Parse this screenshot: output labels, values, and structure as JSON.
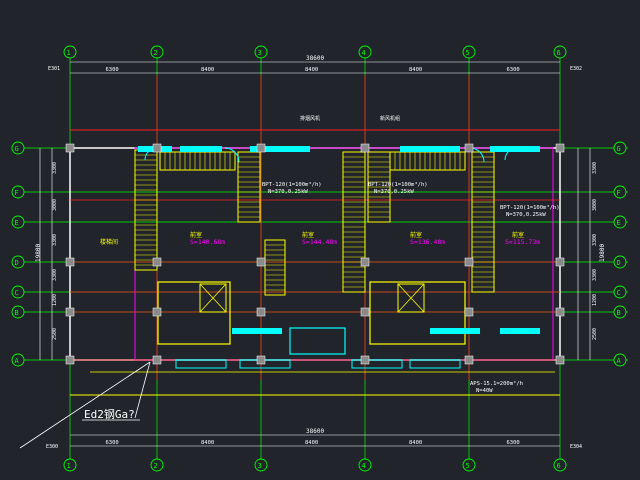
{
  "title": "CAD floor plan drawing",
  "colors": {
    "background": "#21242b",
    "axis": "#00ff00",
    "wall": "#ffffff",
    "grid_red": "#ff2020",
    "yellow": "#ffff00",
    "magenta": "#ff00ff",
    "cyan": "#00ffff",
    "dim": "#ffffff"
  },
  "axes": {
    "columns": [
      "①",
      "②",
      "③",
      "④",
      "⑤",
      "⑥"
    ],
    "rows": [
      "Ⓐ",
      "Ⓑ",
      "Ⓒ",
      "Ⓓ",
      "Ⓔ",
      "Ⓕ",
      "Ⓖ"
    ]
  },
  "dimensions": {
    "top_total": "38600",
    "bottom_total": "38600",
    "bays": [
      "6300",
      "8400",
      "8400",
      "8400",
      "6300"
    ],
    "left_total": "19800",
    "left_segments": [
      "2500",
      "1200",
      "3300",
      "3300",
      "3000",
      "3300"
    ]
  },
  "elevation_marks": {
    "top_left": "E301",
    "top_right": "E302",
    "bottom_left": "E300",
    "bottom_right": "E304"
  },
  "rooms": [
    {
      "label": "前室",
      "area": "S=140.68m"
    },
    {
      "label": "前室",
      "area": "S=144.48m"
    },
    {
      "label": "前室",
      "area": "S=136.48m"
    },
    {
      "label": "前室",
      "area": "S=115.73m"
    }
  ],
  "left_room": "楼梯间",
  "equipment_labels": [
    "BPT-120(1=100m³/h)",
    "N=370,0.25kW",
    "BPT-120(1=100m³/h)",
    "N=370,0.25kW",
    "BPT-120(1=100m³/h)",
    "N=370,0.25kW",
    "APS-15.1=200m³/h",
    "N=40W"
  ],
  "callout": "Ed2钢Ga?",
  "small_notes": [
    "排烟风机",
    "新风机组"
  ]
}
